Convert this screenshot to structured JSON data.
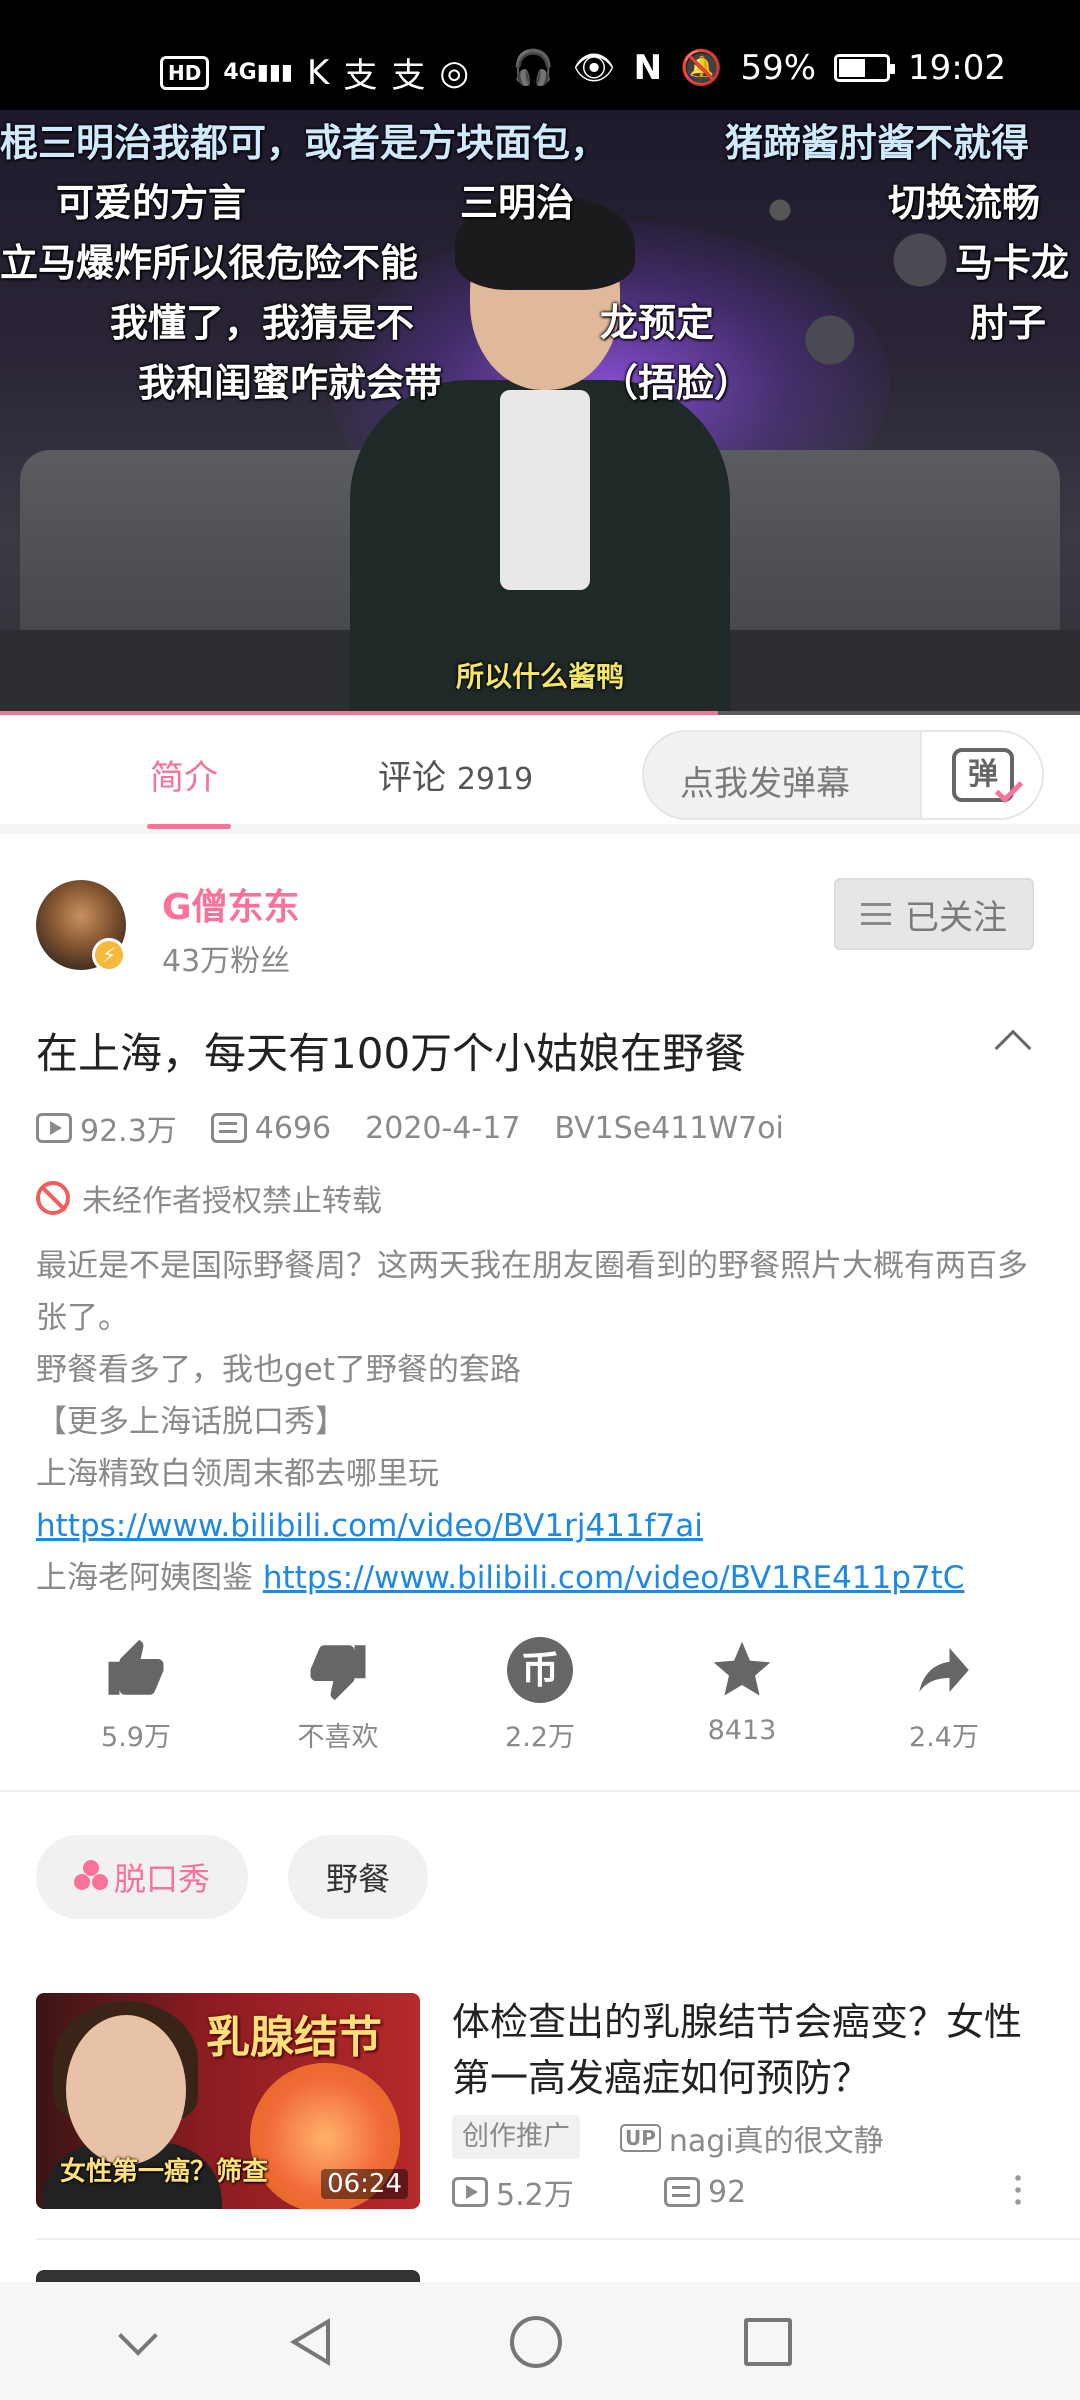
{
  "status_bar": {
    "left_indicators": [
      "HD",
      "4G",
      "K",
      "支",
      "支",
      "◎"
    ],
    "battery_percent": "59%",
    "battery_level": 0.59,
    "time": "19:02"
  },
  "video": {
    "danmaku": [
      "棍三明治我都可，或者是方块面包，",
      "猪蹄酱肘酱不就得",
      "可爱的方言",
      "三明治",
      "切换流畅",
      "立马爆炸所以很危险不能",
      "马卡龙",
      "我懂了，我猜是不",
      "龙预定",
      "肘子",
      "我和闺蜜咋就会带",
      "（捂脸）"
    ],
    "subtitle": "所以什么酱鸭",
    "progress": 0.665
  },
  "tabs": {
    "intro_label": "简介",
    "comments_label": "评论",
    "comments_count": "2919",
    "danmaku_placeholder": "点我发弹幕",
    "danmaku_icon_char": "弹"
  },
  "uploader": {
    "name": "G僧东东",
    "fans": "43万粉丝",
    "follow_label": "已关注"
  },
  "video_info": {
    "title": "在上海，每天有100万个小姑娘在野餐",
    "views": "92.3万",
    "danmaku_count": "4696",
    "date": "2020-4-17",
    "bvid": "BV1Se411W7oi",
    "copyright_notice": "未经作者授权禁止转载",
    "description_lines": [
      "最近是不是国际野餐周？这两天我在朋友圈看到的野餐照片大概有两百多张了。",
      "野餐看多了，我也get了野餐的套路",
      "【更多上海话脱口秀】",
      "上海精致白领周末都去哪里玩"
    ],
    "link1": "https://www.bilibili.com/video/BV1rj411f7ai",
    "link2_prefix": "上海老阿姨图鉴",
    "link2": "https://www.bilibili.com/video/BV1RE411p7tC"
  },
  "actions": {
    "like": "5.9万",
    "dislike": "不喜欢",
    "coin": "2.2万",
    "coin_char": "币",
    "favorite": "8413",
    "share": "2.4万"
  },
  "tags": [
    "脱口秀",
    "野餐"
  ],
  "recommendation": {
    "thumb_title": "乳腺结节",
    "thumb_subtitle": "女性第一癌？筛查",
    "duration": "06:24",
    "title": "体检查出的乳腺结节会癌变？女性第一高发癌症如何预防？",
    "tag": "创作推广",
    "up_badge": "UP",
    "uploader": "nagi真的很文静",
    "views": "5.2万",
    "danmaku": "92"
  },
  "colors": {
    "accent": "#fb7299",
    "link": "#1e88e5",
    "muted": "#8a8a8a"
  }
}
